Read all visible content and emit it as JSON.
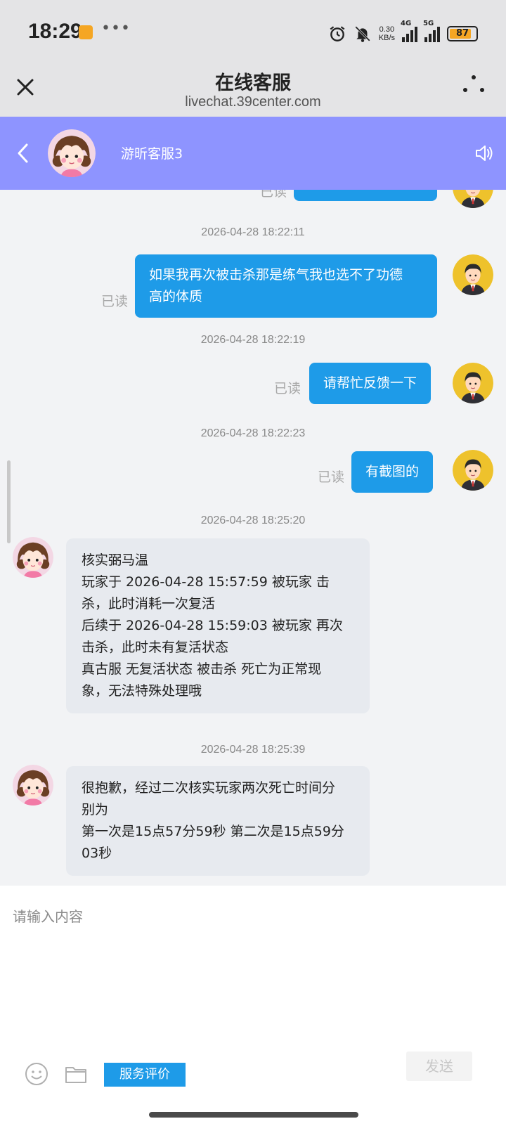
{
  "status_bar": {
    "time": "18:29",
    "net_speed_value": "0.30",
    "net_speed_unit": "KB/s",
    "signal_1_label": "4G",
    "signal_2_label": "5G",
    "battery": "87"
  },
  "browser": {
    "title": "在线客服",
    "url": "livechat.39center.com"
  },
  "chat_header": {
    "agent_name": "游昕客服3",
    "header_color": "#8e94ff"
  },
  "messages": [
    {
      "timestamp": "2026-04-28 18:22:11",
      "from": "user",
      "text_lines": [
        "如果我再次被击杀那是练气我也选不了功德",
        "高的体质"
      ],
      "status": "已读"
    },
    {
      "timestamp": "2026-04-28 18:22:19",
      "from": "user",
      "text_lines": [
        "请帮忙反馈一下"
      ],
      "status": "已读"
    },
    {
      "timestamp": "2026-04-28 18:22:23",
      "from": "user",
      "text_lines": [
        "有截图的"
      ],
      "status": "已读"
    },
    {
      "timestamp": "2026-04-28 18:25:20",
      "from": "agent",
      "text_lines": [
        "核实弼马温",
        "玩家于 2026-04-28 15:57:59 被玩家 击",
        "杀，此时消耗一次复活",
        "后续于 2026-04-28 15:59:03 被玩家 再次",
        "击杀，此时未有复活状态",
        "真古服 无复活状态 被击杀 死亡为正常现",
        "象，无法特殊处理哦"
      ]
    },
    {
      "timestamp": "2026-04-28 18:25:39",
      "from": "agent",
      "text_lines": [
        "很抱歉，经过二次核实玩家两次死亡时间分",
        "别为",
        "第一次是15点57分59秒 第二次是15点59分",
        "03秒"
      ]
    }
  ],
  "partial_top_message": {
    "status": "已读"
  },
  "composer": {
    "placeholder": "请输入内容",
    "rate_button": "服务评价",
    "send_button": "发送"
  },
  "colors": {
    "outgoing_bubble": "#1e9be8",
    "incoming_bubble": "#e7eaef",
    "background": "#f2f3f5"
  }
}
